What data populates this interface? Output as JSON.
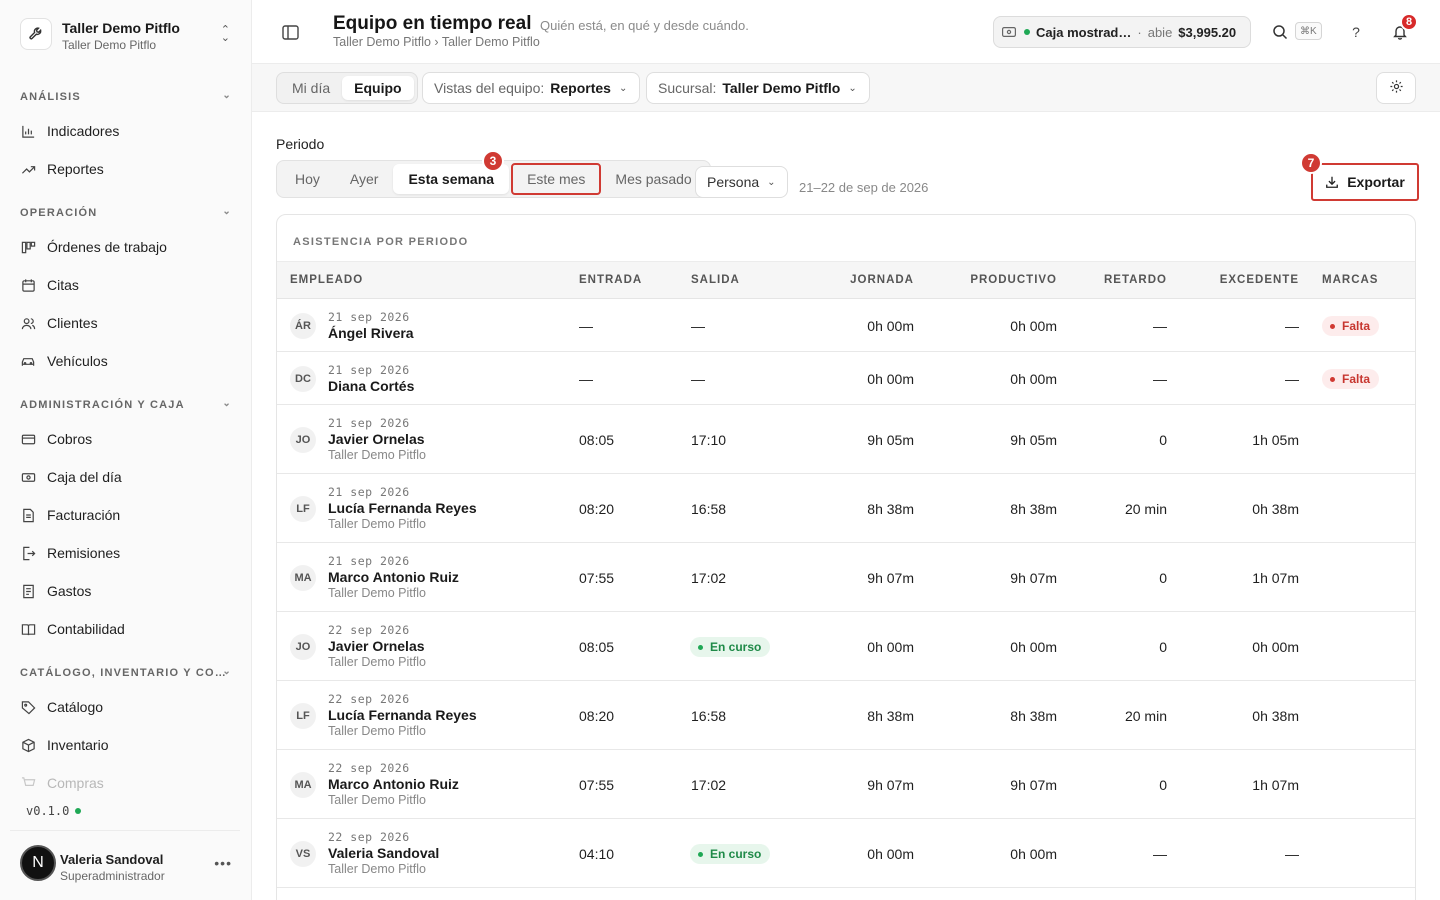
{
  "sidebar": {
    "brand_title": "Taller Demo Pitflo",
    "brand_sub": "Taller Demo Pitflo",
    "sections": [
      {
        "label": "ANÁLISIS",
        "items": [
          {
            "label": "Indicadores",
            "icon": "bar-chart-icon"
          },
          {
            "label": "Reportes",
            "icon": "trend-icon"
          }
        ]
      },
      {
        "label": "OPERACIÓN",
        "items": [
          {
            "label": "Órdenes de trabajo",
            "icon": "kanban-icon"
          },
          {
            "label": "Citas",
            "icon": "calendar-icon"
          },
          {
            "label": "Clientes",
            "icon": "users-icon"
          },
          {
            "label": "Vehículos",
            "icon": "car-icon"
          }
        ]
      },
      {
        "label": "ADMINISTRACIÓN Y CAJA",
        "items": [
          {
            "label": "Cobros",
            "icon": "card-icon"
          },
          {
            "label": "Caja del día",
            "icon": "cash-icon"
          },
          {
            "label": "Facturación",
            "icon": "invoice-icon"
          },
          {
            "label": "Remisiones",
            "icon": "export-doc-icon"
          },
          {
            "label": "Gastos",
            "icon": "receipt-icon"
          },
          {
            "label": "Contabilidad",
            "icon": "book-icon"
          }
        ]
      },
      {
        "label": "CATÁLOGO, INVENTARIO Y CO…",
        "items": [
          {
            "label": "Catálogo",
            "icon": "tag-icon"
          },
          {
            "label": "Inventario",
            "icon": "box-icon"
          },
          {
            "label": "Compras",
            "icon": "cart-icon"
          }
        ]
      }
    ],
    "version": "v0.1.0",
    "user": {
      "initial": "N",
      "name": "Valeria Sandoval",
      "role": "Superadministrador"
    }
  },
  "header": {
    "title": "Equipo en tiempo real",
    "subtitle": "Quién está, en qué y desde cuándo.",
    "breadcrumb": "Taller Demo Pitflo › Taller Demo Pitflo",
    "cash": {
      "name": "Caja mostrad…",
      "sep": "·",
      "status": "abie",
      "amount": "$3,995.20"
    },
    "kbd": "⌘K",
    "help": "?",
    "notifications": "8"
  },
  "toolbar": {
    "tabs": [
      "Mi día",
      "Equipo"
    ],
    "active_tab": "Equipo",
    "views_label": "Vistas del equipo:",
    "views_value": "Reportes",
    "branch_label": "Sucursal:",
    "branch_value": "Taller Demo Pitflo"
  },
  "period": {
    "label": "Periodo",
    "options": [
      "Hoy",
      "Ayer",
      "Esta semana",
      "Este mes",
      "Mes pasado"
    ],
    "active": "Esta semana",
    "highlight_badge": "3",
    "group_by": "Persona",
    "range": "21–22 de sep de 2026",
    "export_label": "Exportar",
    "export_badge": "7"
  },
  "table": {
    "title": "ASISTENCIA POR PERIODO",
    "columns": {
      "empleado": "EMPLEADO",
      "entrada": "ENTRADA",
      "salida": "SALIDA",
      "jornada": "JORNADA",
      "productivo": "PRODUCTIVO",
      "retardo": "RETARDO",
      "excedente": "EXCEDENTE",
      "marcas": "MARCAS"
    },
    "rows": [
      {
        "ini": "ÁR",
        "date": "21 sep 2026",
        "name": "Ángel Rivera",
        "branch": "",
        "entrada": "—",
        "salida": "—",
        "salida_pill": "",
        "jornada": "0h 00m",
        "productivo": "0h 00m",
        "retardo": "—",
        "excedente": "—",
        "marca": "Falta"
      },
      {
        "ini": "DC",
        "date": "21 sep 2026",
        "name": "Diana Cortés",
        "branch": "",
        "entrada": "—",
        "salida": "—",
        "salida_pill": "",
        "jornada": "0h 00m",
        "productivo": "0h 00m",
        "retardo": "—",
        "excedente": "—",
        "marca": "Falta"
      },
      {
        "ini": "JO",
        "date": "21 sep 2026",
        "name": "Javier Ornelas",
        "branch": "Taller Demo Pitflo",
        "entrada": "08:05",
        "salida": "17:10",
        "salida_pill": "",
        "jornada": "9h 05m",
        "productivo": "9h 05m",
        "retardo": "0",
        "excedente": "1h 05m",
        "marca": ""
      },
      {
        "ini": "LF",
        "date": "21 sep 2026",
        "name": "Lucía Fernanda Reyes",
        "branch": "Taller Demo Pitflo",
        "entrada": "08:20",
        "salida": "16:58",
        "salida_pill": "",
        "jornada": "8h 38m",
        "productivo": "8h 38m",
        "retardo": "20 min",
        "excedente": "0h 38m",
        "marca": ""
      },
      {
        "ini": "MA",
        "date": "21 sep 2026",
        "name": "Marco Antonio Ruiz",
        "branch": "Taller Demo Pitflo",
        "entrada": "07:55",
        "salida": "17:02",
        "salida_pill": "",
        "jornada": "9h 07m",
        "productivo": "9h 07m",
        "retardo": "0",
        "excedente": "1h 07m",
        "marca": ""
      },
      {
        "ini": "JO",
        "date": "22 sep 2026",
        "name": "Javier Ornelas",
        "branch": "Taller Demo Pitflo",
        "entrada": "08:05",
        "salida": "",
        "salida_pill": "En curso",
        "jornada": "0h 00m",
        "productivo": "0h 00m",
        "retardo": "0",
        "excedente": "0h 00m",
        "marca": ""
      },
      {
        "ini": "LF",
        "date": "22 sep 2026",
        "name": "Lucía Fernanda Reyes",
        "branch": "Taller Demo Pitflo",
        "entrada": "08:20",
        "salida": "16:58",
        "salida_pill": "",
        "jornada": "8h 38m",
        "productivo": "8h 38m",
        "retardo": "20 min",
        "excedente": "0h 38m",
        "marca": ""
      },
      {
        "ini": "MA",
        "date": "22 sep 2026",
        "name": "Marco Antonio Ruiz",
        "branch": "Taller Demo Pitflo",
        "entrada": "07:55",
        "salida": "17:02",
        "salida_pill": "",
        "jornada": "9h 07m",
        "productivo": "9h 07m",
        "retardo": "0",
        "excedente": "1h 07m",
        "marca": ""
      },
      {
        "ini": "VS",
        "date": "22 sep 2026",
        "name": "Valeria Sandoval",
        "branch": "Taller Demo Pitflo",
        "entrada": "04:10",
        "salida": "",
        "salida_pill": "En curso",
        "jornada": "0h 00m",
        "productivo": "0h 00m",
        "retardo": "—",
        "excedente": "—",
        "marca": ""
      }
    ]
  }
}
